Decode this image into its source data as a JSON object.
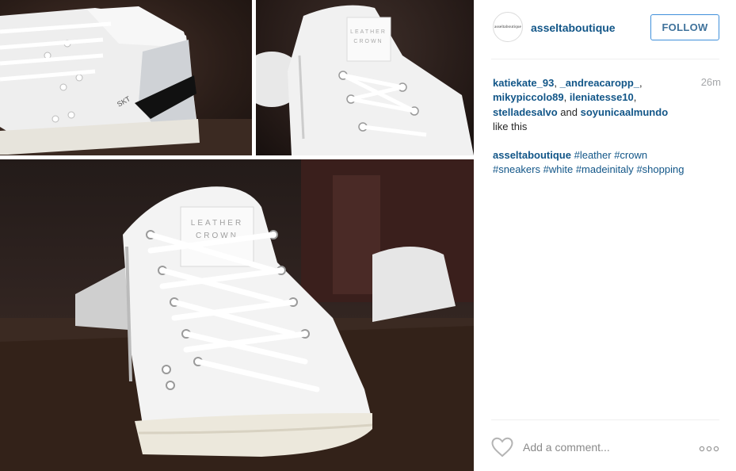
{
  "post": {
    "images": [
      {
        "alt_icon": "sneaker-photo"
      },
      {
        "alt_icon": "sneaker-photo"
      },
      {
        "alt_icon": "sneaker-photo"
      }
    ]
  },
  "header": {
    "avatar_text": "asseltaboutique",
    "username": "asseltaboutique",
    "follow_label": "FOLLOW"
  },
  "likes": {
    "users": [
      "katiekate_93",
      "_andreacaropp_",
      "mikypiccolo89",
      "ileniatesse10",
      "stelladesalvo",
      "soyunicaalmundo"
    ],
    "and_text": "and",
    "suffix": "like this",
    "time": "26m"
  },
  "caption": {
    "user": "asseltaboutique",
    "hashtags": [
      "#leather",
      "#crown",
      "#sneakers",
      "#white",
      "#madeinitaly",
      "#shopping"
    ]
  },
  "footer": {
    "comment_placeholder": "Add a comment...",
    "like_icon": "heart-outline-icon",
    "more_icon": "ellipsis-icon"
  },
  "colors": {
    "link": "#125688",
    "follow_border": "#4090db",
    "follow_text": "#3f729b",
    "muted": "#a5a7aa",
    "divider": "#efefef"
  }
}
